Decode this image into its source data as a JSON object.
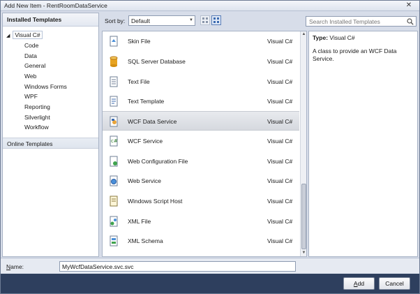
{
  "window": {
    "title": "Add New Item - RentRoomDataService",
    "close_glyph": "✕"
  },
  "left": {
    "header": "Installed Templates",
    "root": {
      "arrow": "◢",
      "label": "Visual C#"
    },
    "items": [
      "Code",
      "Data",
      "General",
      "Web",
      "Windows Forms",
      "WPF",
      "Reporting",
      "Silverlight",
      "Workflow"
    ],
    "online": "Online Templates"
  },
  "sortbar": {
    "label": "Sort by:",
    "value": "Default",
    "dropdown_glyph": "▼"
  },
  "list": {
    "rows": [
      {
        "name": "Skin File",
        "lang": "Visual C#",
        "icon": "skin-file-icon"
      },
      {
        "name": "SQL Server Database",
        "lang": "Visual C#",
        "icon": "database-icon"
      },
      {
        "name": "Text File",
        "lang": "Visual C#",
        "icon": "text-file-icon"
      },
      {
        "name": "Text Template",
        "lang": "Visual C#",
        "icon": "text-template-icon"
      },
      {
        "name": "WCF Data Service",
        "lang": "Visual C#",
        "icon": "wcf-data-service-icon",
        "selected": true
      },
      {
        "name": "WCF Service",
        "lang": "Visual C#",
        "icon": "wcf-service-icon"
      },
      {
        "name": "Web Configuration File",
        "lang": "Visual C#",
        "icon": "web-config-icon"
      },
      {
        "name": "Web Service",
        "lang": "Visual C#",
        "icon": "web-service-icon"
      },
      {
        "name": "Windows Script Host",
        "lang": "Visual C#",
        "icon": "script-host-icon"
      },
      {
        "name": "XML File",
        "lang": "Visual C#",
        "icon": "xml-file-icon"
      },
      {
        "name": "XML Schema",
        "lang": "Visual C#",
        "icon": "xml-schema-icon"
      }
    ]
  },
  "search": {
    "placeholder": "Search Installed Templates"
  },
  "detail": {
    "type_label": "Type:",
    "type_value": "Visual C#",
    "description": "A class to provide an WCF Data Service."
  },
  "name": {
    "label_prefix": "N",
    "label_rest": "ame:",
    "value": "MyWcfDataService.svc.svc"
  },
  "buttons": {
    "add_prefix": "A",
    "add_rest": "dd",
    "cancel": "Cancel"
  },
  "colors": {
    "selected_row": "#d6d9df",
    "button_bar": "#2e3f5e"
  }
}
